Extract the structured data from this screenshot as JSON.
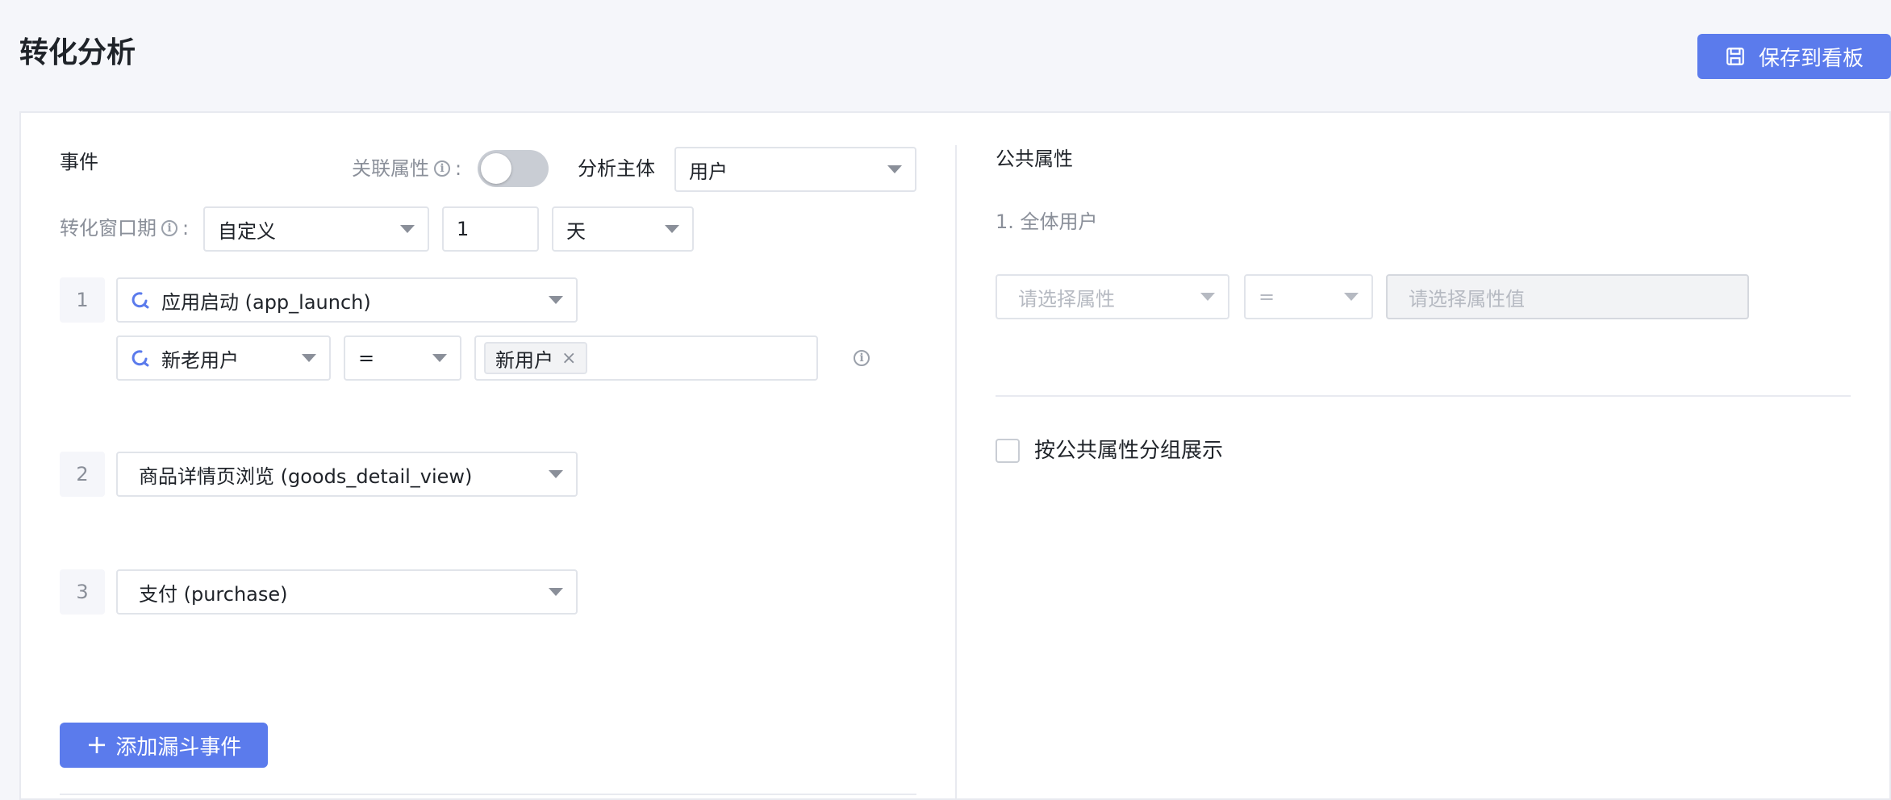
{
  "header": {
    "title": "转化分析",
    "save_label": "保存到看板"
  },
  "events_panel": {
    "section_title": "事件",
    "assoc_attr_label": "关联属性",
    "assoc_attr_enabled": false,
    "subject_label": "分析主体",
    "subject_value": "用户",
    "window_label": "转化窗口期",
    "window_mode": "自定义",
    "window_amount": "1",
    "window_unit": "天",
    "colon": ":",
    "steps": [
      {
        "num": "1",
        "event": "应用启动 (app_launch)",
        "has_icon": true
      },
      {
        "num": "2",
        "event": "商品详情页浏览 (goods_detail_view)",
        "has_icon": false
      },
      {
        "num": "3",
        "event": "支付 (purchase)",
        "has_icon": false
      }
    ],
    "filter": {
      "property": "新老用户",
      "operator": "=",
      "value_tag": "新用户",
      "remove_symbol": "×"
    },
    "add_step_label": "添加漏斗事件",
    "add_symbol": "+"
  },
  "common_panel": {
    "section_title": "公共属性",
    "group_label": "1. 全体用户",
    "attr_placeholder": "请选择属性",
    "operator": "=",
    "value_placeholder": "请选择属性值",
    "group_by_label": "按公共属性分组展示",
    "group_by_checked": false
  },
  "colors": {
    "primary": "#5b7bec",
    "event_icon": "#5b7bec"
  },
  "icons": {
    "save": "save-icon",
    "event": "event-search-icon",
    "info": "info-icon"
  }
}
